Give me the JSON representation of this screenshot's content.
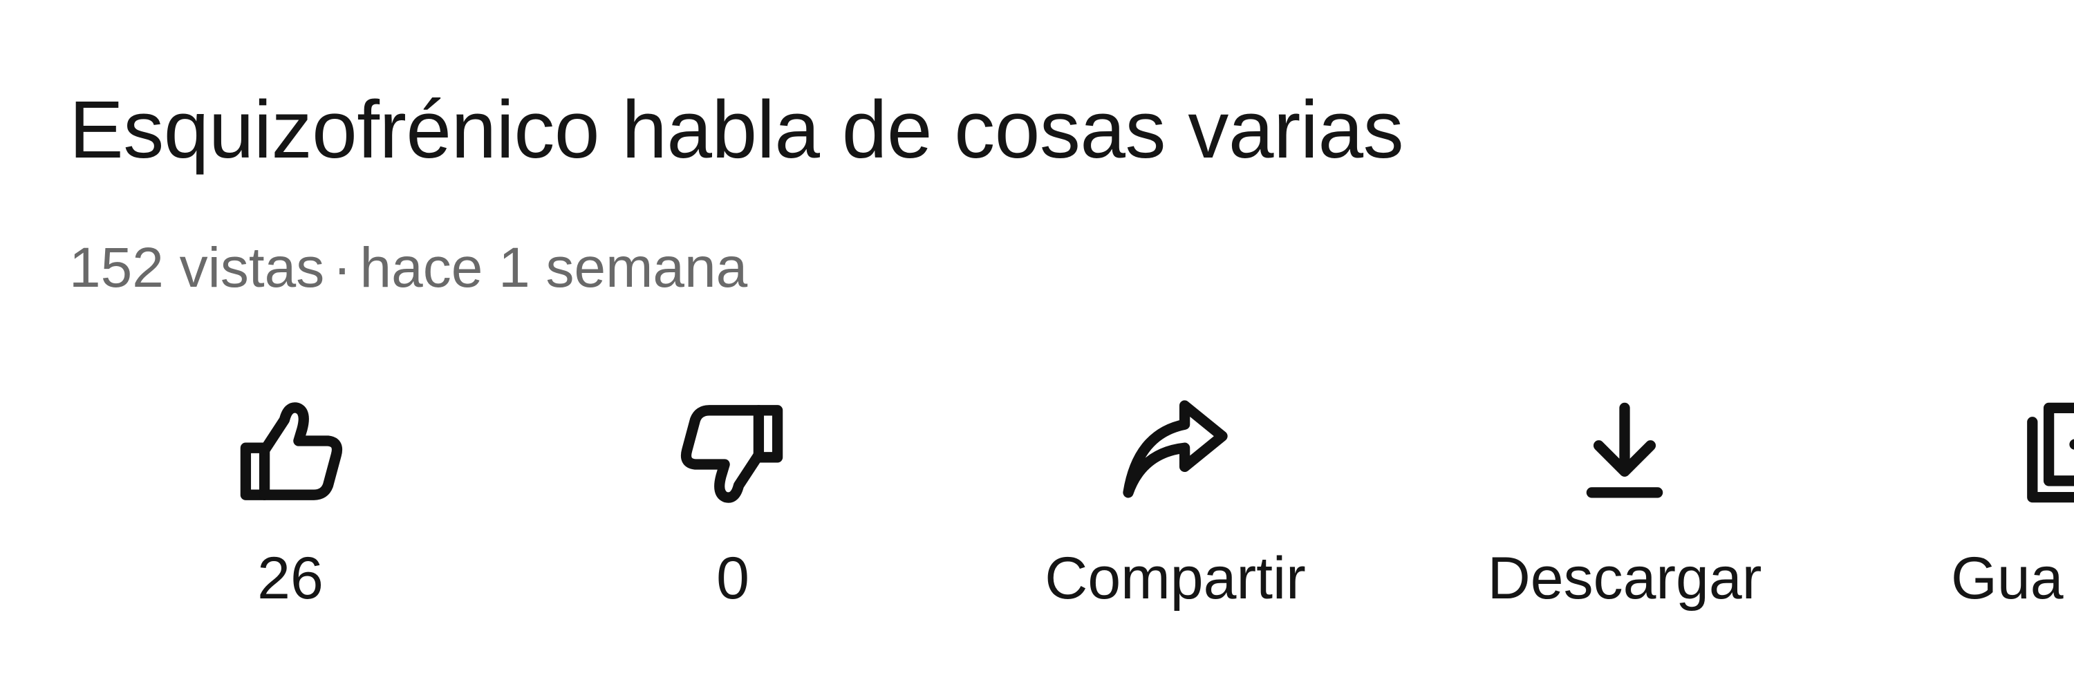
{
  "video": {
    "title": "Esquizofrénico habla de cosas varias",
    "views": "152 vistas",
    "separator": "·",
    "age": "hace 1 semana"
  },
  "actions": {
    "like": {
      "icon": "thumbs-up-icon",
      "label": "26"
    },
    "dislike": {
      "icon": "thumbs-down-icon",
      "label": "0"
    },
    "share": {
      "icon": "share-arrow-icon",
      "label": "Compartir"
    },
    "download": {
      "icon": "download-icon",
      "label": "Descargar"
    },
    "save": {
      "icon": "save-to-playlist-icon",
      "label": "Gua"
    }
  },
  "colors": {
    "background": "#ffffff",
    "text": "#151515",
    "meta_text": "#6a6a6a"
  }
}
